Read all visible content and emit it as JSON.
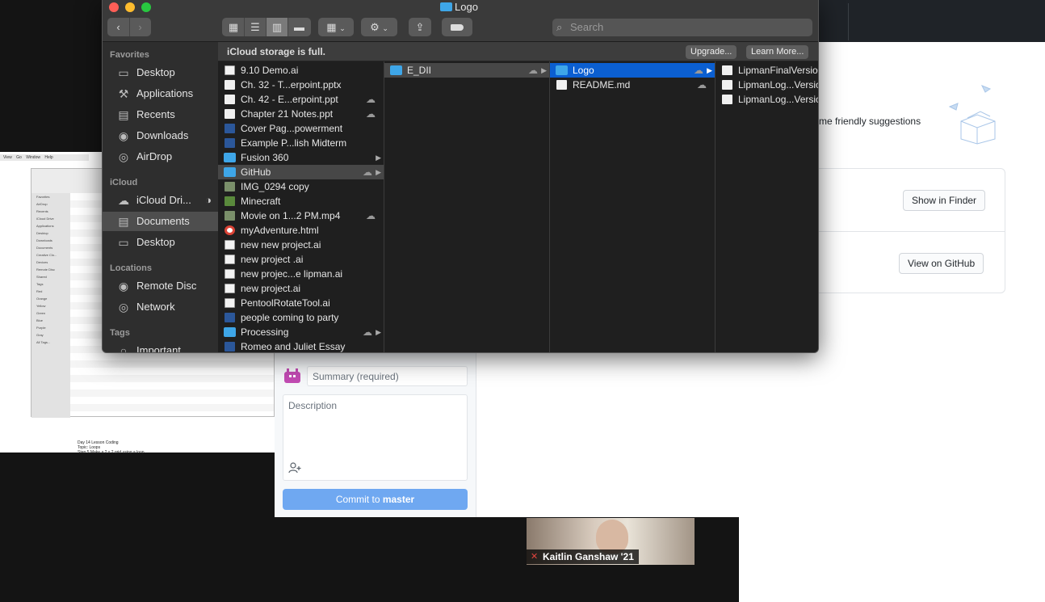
{
  "finder": {
    "title": "Logo",
    "search_placeholder": "Search",
    "banner": {
      "text": "iCloud storage is full.",
      "upgrade": "Upgrade...",
      "learn_more": "Learn More..."
    },
    "sidebar": {
      "favorites_header": "Favorites",
      "favorites": [
        {
          "label": "Desktop",
          "icon": "desktop-icon"
        },
        {
          "label": "Applications",
          "icon": "applications-icon"
        },
        {
          "label": "Recents",
          "icon": "recents-icon"
        },
        {
          "label": "Downloads",
          "icon": "downloads-icon"
        },
        {
          "label": "AirDrop",
          "icon": "airdrop-icon"
        }
      ],
      "icloud_header": "iCloud",
      "icloud": [
        {
          "label": "iCloud Dri...",
          "icon": "cloud-icon"
        },
        {
          "label": "Documents",
          "icon": "documents-icon"
        },
        {
          "label": "Desktop",
          "icon": "desktop-icon"
        }
      ],
      "locations_header": "Locations",
      "locations": [
        {
          "label": "Remote Disc",
          "icon": "disc-icon"
        },
        {
          "label": "Network",
          "icon": "network-icon"
        }
      ],
      "tags_header": "Tags",
      "tags": [
        {
          "label": "Important"
        }
      ]
    },
    "col1": [
      {
        "name": "9.10 Demo.ai",
        "type": "ai"
      },
      {
        "name": "Ch. 32 - T...erpoint.pptx",
        "type": "doc"
      },
      {
        "name": "Ch. 42 - E...erpoint.ppt",
        "type": "doc",
        "cloud": true
      },
      {
        "name": "Chapter 21 Notes.ppt",
        "type": "doc",
        "cloud": true
      },
      {
        "name": "Cover Pag...powerment",
        "type": "word"
      },
      {
        "name": "Example P...lish Midterm",
        "type": "word"
      },
      {
        "name": "Fusion 360",
        "type": "folder",
        "arrow": true
      },
      {
        "name": "GitHub",
        "type": "folder",
        "arrow": true,
        "cloud": true,
        "hl": true
      },
      {
        "name": "IMG_0294 copy",
        "type": "img"
      },
      {
        "name": "Minecraft",
        "type": "mc"
      },
      {
        "name": "Movie on 1...2 PM.mp4",
        "type": "img",
        "cloud": true
      },
      {
        "name": "myAdventure.html",
        "type": "html"
      },
      {
        "name": "new new project.ai",
        "type": "ai"
      },
      {
        "name": "new project .ai",
        "type": "ai"
      },
      {
        "name": "new projec...e lipman.ai",
        "type": "ai"
      },
      {
        "name": "new project.ai",
        "type": "ai"
      },
      {
        "name": "PentoolRotateTool.ai",
        "type": "ai"
      },
      {
        "name": "people coming to party",
        "type": "word"
      },
      {
        "name": "Processing",
        "type": "folder",
        "arrow": true,
        "cloud": true
      },
      {
        "name": "Romeo and Juliet Essay",
        "type": "word"
      }
    ],
    "col2": [
      {
        "name": "E_DII",
        "type": "folder",
        "arrow": true,
        "cloud": true,
        "hl": true
      }
    ],
    "col3": [
      {
        "name": "Logo",
        "type": "folder",
        "arrow": true,
        "cloud": true,
        "sel": true
      },
      {
        "name": "README.md",
        "type": "doc",
        "cloud": true
      }
    ],
    "col4": [
      {
        "name": "LipmanFinalVersion",
        "type": "doc"
      },
      {
        "name": "LipmanLog...Version",
        "type": "doc"
      },
      {
        "name": "LipmanLog...Version",
        "type": "doc"
      }
    ]
  },
  "github": {
    "suggestion_text": "me friendly suggestions",
    "show_in_finder": "Show in Finder",
    "view_on_github": "View on GitHub",
    "summary_placeholder": "Summary (required)",
    "description_placeholder": "Description",
    "commit_prefix": "Commit to ",
    "commit_branch": "master"
  },
  "zoom": {
    "participant_name": "Kaitlin Ganshaw '21"
  },
  "left_screenshot": {
    "menubar": "View Go Window Help",
    "sidebar_lines": [
      "Favorites",
      "AirDrop",
      "Recents",
      "iCloud Drive",
      "Applications",
      "Desktop",
      "Downloads",
      "Documents",
      "Creative Clo...",
      "Devices",
      "Remote Disc",
      "Shared",
      "Tags",
      "Red",
      "Orange",
      "Yellow",
      "Green",
      "Blue",
      "Purple",
      "Gray",
      "All Tags..."
    ],
    "footer_lines": [
      "Day 14 Lesson Coding",
      "Topic: Loops",
      "Step 5 Make a 2 x 2 grid using a loop"
    ]
  },
  "colors": {
    "accent": "#0b5fd1",
    "commit_button": "#6fa8f1",
    "folder": "#3ea6e8"
  }
}
